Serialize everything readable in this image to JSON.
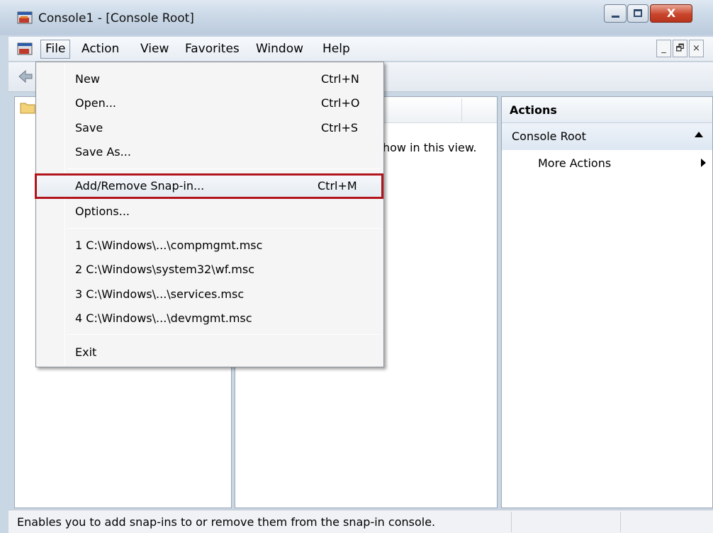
{
  "window": {
    "title": "Console1 - [Console Root]",
    "close_glyph": "X"
  },
  "menubar": {
    "items": [
      {
        "label": "File"
      },
      {
        "label": "Action"
      },
      {
        "label": "View"
      },
      {
        "label": "Favorites"
      },
      {
        "label": "Window"
      },
      {
        "label": "Help"
      }
    ],
    "mdi": {
      "minimize": "_",
      "restore": "🗗",
      "close": "×"
    }
  },
  "file_menu": {
    "items": [
      {
        "label": "New",
        "shortcut": "Ctrl+N"
      },
      {
        "label": "Open...",
        "shortcut": "Ctrl+O"
      },
      {
        "label": "Save",
        "shortcut": "Ctrl+S"
      },
      {
        "label": "Save As...",
        "shortcut": ""
      },
      {
        "label": "Add/Remove Snap-in...",
        "shortcut": "Ctrl+M"
      },
      {
        "label": "Options...",
        "shortcut": ""
      },
      {
        "label": "1 C:\\Windows\\...\\compmgmt.msc",
        "shortcut": ""
      },
      {
        "label": "2 C:\\Windows\\system32\\wf.msc",
        "shortcut": ""
      },
      {
        "label": "3 C:\\Windows\\...\\services.msc",
        "shortcut": ""
      },
      {
        "label": "4 C:\\Windows\\...\\devmgmt.msc",
        "shortcut": ""
      },
      {
        "label": "Exit",
        "shortcut": ""
      }
    ]
  },
  "center": {
    "empty_text": "how in this view."
  },
  "actions": {
    "header": "Actions",
    "group": "Console Root",
    "more": "More Actions"
  },
  "statusbar": {
    "text": "Enables you to add snap-ins to or remove them from the snap-in console."
  },
  "colors": {
    "highlight_border": "#b2141c",
    "window_chrome": "#c9d6e4"
  }
}
